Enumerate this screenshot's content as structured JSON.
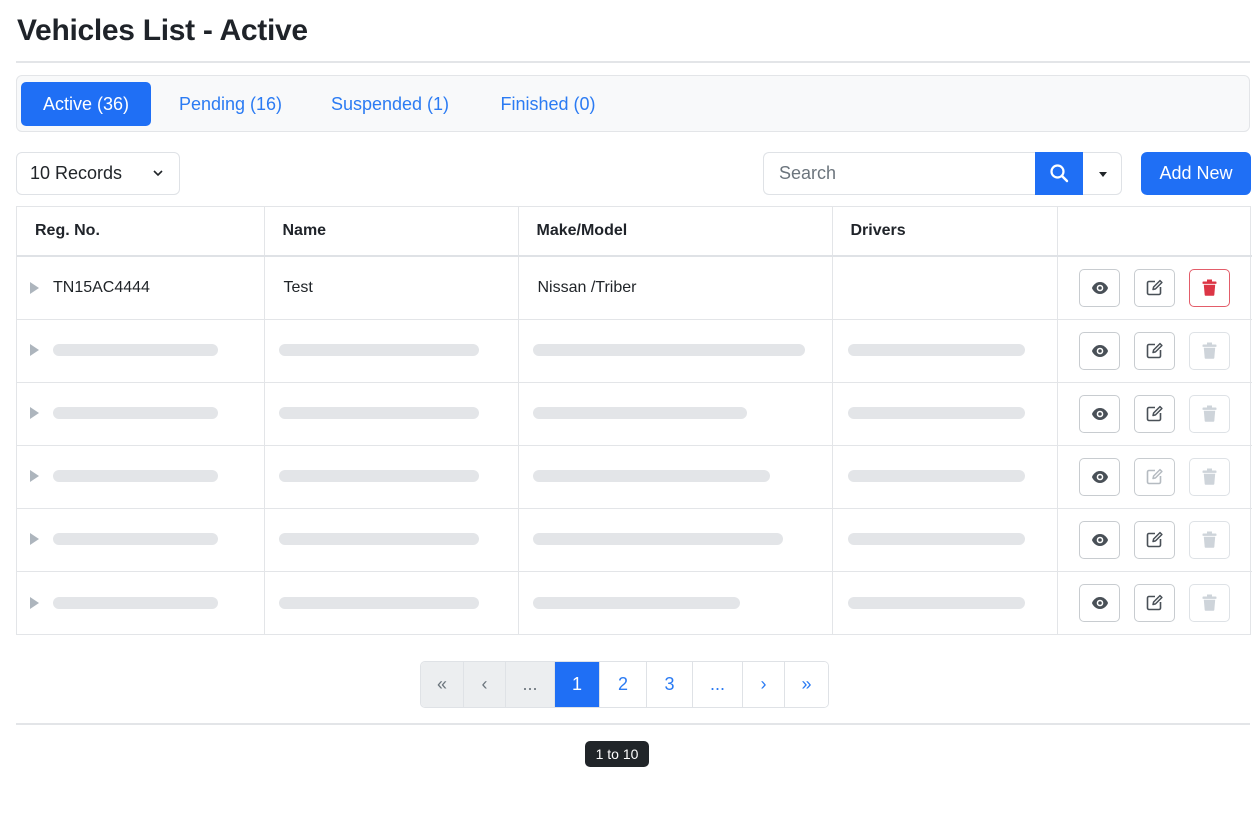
{
  "page": {
    "title": "Vehicles List - Active"
  },
  "tabs": [
    {
      "label": "Active (36)",
      "active": true
    },
    {
      "label": "Pending (16)",
      "active": false
    },
    {
      "label": "Suspended (1)",
      "active": false
    },
    {
      "label": "Finished (0)",
      "active": false
    }
  ],
  "toolbar": {
    "records_label": "10 Records",
    "search_placeholder": "Search",
    "search_value": "",
    "add_label": "Add New"
  },
  "table": {
    "columns": [
      "Reg. No.",
      "Name",
      "Make/Model",
      "Drivers",
      ""
    ],
    "rows": [
      {
        "reg_no": "TN15AC4444",
        "name": "Test",
        "make_model": "Nissan /Triber",
        "drivers": "",
        "loading": false
      },
      {
        "loading": true
      },
      {
        "loading": true
      },
      {
        "loading": true
      },
      {
        "loading": true
      },
      {
        "loading": true
      }
    ],
    "row_actions": [
      "eye-icon",
      "edit-icon",
      "trash-icon"
    ]
  },
  "pagination": {
    "items": [
      {
        "label": "«",
        "kind": "first",
        "disabled": true
      },
      {
        "label": "‹",
        "kind": "prev",
        "disabled": true
      },
      {
        "label": "...",
        "kind": "ellipsis",
        "disabled": true
      },
      {
        "label": "1",
        "kind": "page",
        "current": true
      },
      {
        "label": "2",
        "kind": "page"
      },
      {
        "label": "3",
        "kind": "page"
      },
      {
        "label": "...",
        "kind": "ellipsis"
      },
      {
        "label": "›",
        "kind": "next"
      },
      {
        "label": "»",
        "kind": "last"
      }
    ]
  },
  "footer": {
    "range_label": "1 to 10"
  },
  "colors": {
    "primary": "#1f6ff5",
    "link": "#2b7bf3",
    "danger": "#dc3545",
    "skeleton": "#e3e5e8",
    "badge": "#212529"
  }
}
